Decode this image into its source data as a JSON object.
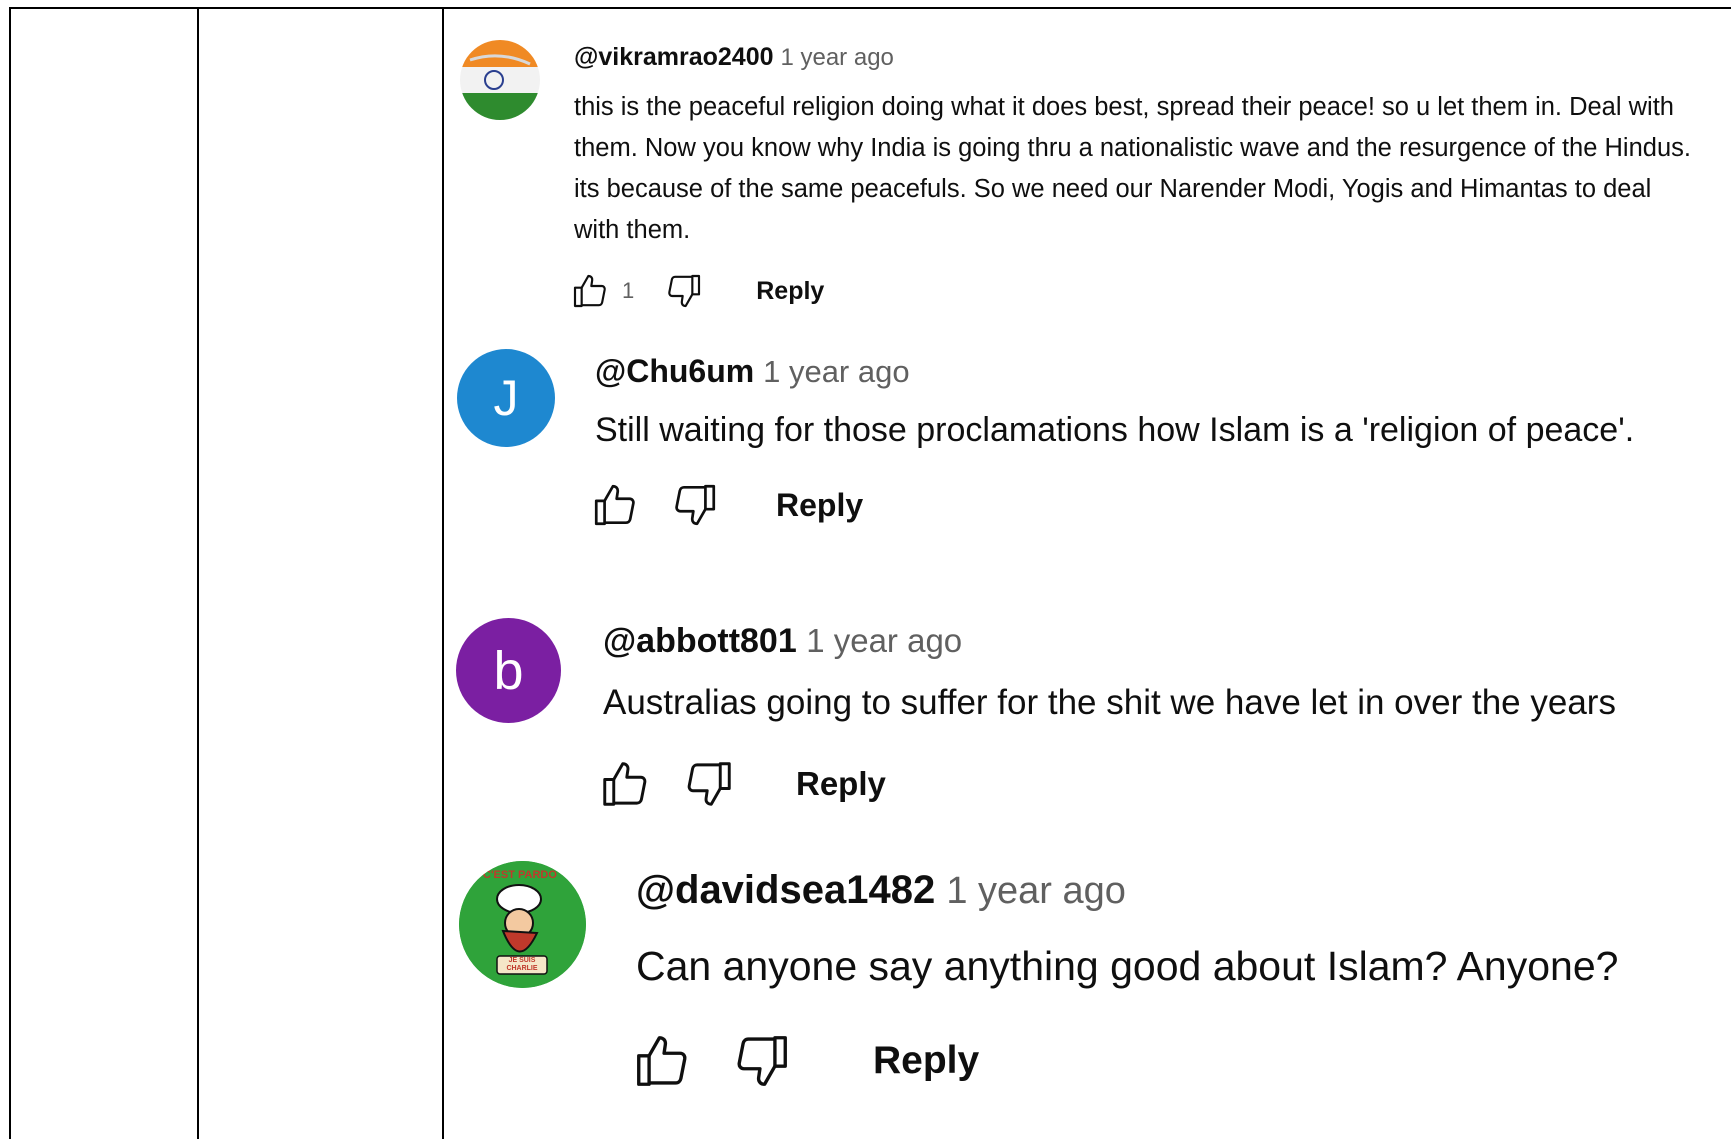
{
  "comments": [
    {
      "handle": "@vikramrao2400",
      "time": "1 year ago",
      "text": "this is the peaceful religion doing what it does best, spread their peace! so u let them in. Deal with them. Now you know why India is going thru a nationalistic wave and the resurgence of the Hindus. its because of the same peacefuls. So we need our Narender Modi, Yogis and Himantas to deal with them.",
      "likes": "1",
      "reply_label": "Reply",
      "avatar": "india-flag-avatar"
    },
    {
      "handle": "@Chu6um",
      "time": "1 year ago",
      "text": "Still waiting for those proclamations how Islam is a 'religion of peace'.",
      "likes": "",
      "reply_label": "Reply",
      "avatar_letter": "J",
      "avatar_color": "#1e88d0"
    },
    {
      "handle": "@abbott801",
      "time": "1 year ago",
      "text": "Australias going to suffer for the shit we have let in over the years",
      "likes": "",
      "reply_label": "Reply",
      "avatar_letter": "b",
      "avatar_color": "#7b1fa2"
    },
    {
      "handle": "@davidsea1482",
      "time": "1 year ago",
      "text": "Can anyone say anything good about Islam? Anyone?",
      "likes": "",
      "reply_label": "Reply",
      "avatar": "charlie-cartoon-avatar",
      "avatar_texts": [
        "C'EST PARDO",
        "JE SUIS CHARLIE"
      ]
    }
  ],
  "icons": {
    "like": "thumbs-up-icon",
    "dislike": "thumbs-down-icon"
  },
  "colors": {
    "text": "#0f0f0f",
    "secondary": "#606060",
    "border": "#000000"
  }
}
